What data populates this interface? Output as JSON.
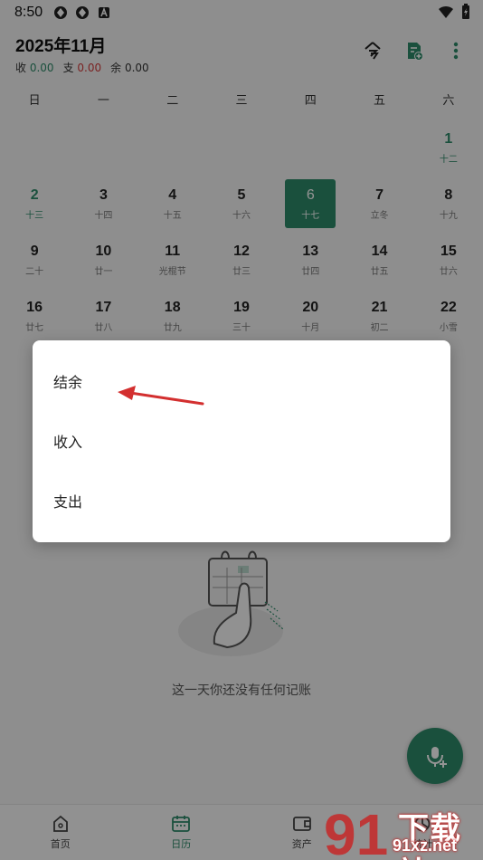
{
  "status_bar": {
    "time": "8:50"
  },
  "header": {
    "title": "2025年11月",
    "income_label": "收",
    "income_value": "0.00",
    "expense_label": "支",
    "expense_value": "0.00",
    "balance_label": "余",
    "balance_value": "0.00"
  },
  "calendar": {
    "weekdays": [
      "日",
      "一",
      "二",
      "三",
      "四",
      "五",
      "六"
    ],
    "days": [
      {
        "num": "",
        "lunar": ""
      },
      {
        "num": "",
        "lunar": ""
      },
      {
        "num": "",
        "lunar": ""
      },
      {
        "num": "",
        "lunar": ""
      },
      {
        "num": "",
        "lunar": ""
      },
      {
        "num": "",
        "lunar": ""
      },
      {
        "num": "1",
        "lunar": "十二"
      },
      {
        "num": "2",
        "lunar": "十三"
      },
      {
        "num": "3",
        "lunar": "十四"
      },
      {
        "num": "4",
        "lunar": "十五"
      },
      {
        "num": "5",
        "lunar": "十六"
      },
      {
        "num": "6",
        "lunar": "十七"
      },
      {
        "num": "7",
        "lunar": "立冬"
      },
      {
        "num": "8",
        "lunar": "十九"
      },
      {
        "num": "9",
        "lunar": "二十"
      },
      {
        "num": "10",
        "lunar": "廿一"
      },
      {
        "num": "11",
        "lunar": "光棍节"
      },
      {
        "num": "12",
        "lunar": "廿三"
      },
      {
        "num": "13",
        "lunar": "廿四"
      },
      {
        "num": "14",
        "lunar": "廿五"
      },
      {
        "num": "15",
        "lunar": "廿六"
      },
      {
        "num": "16",
        "lunar": "廿七"
      },
      {
        "num": "17",
        "lunar": "廿八"
      },
      {
        "num": "18",
        "lunar": "廿九"
      },
      {
        "num": "19",
        "lunar": "三十"
      },
      {
        "num": "20",
        "lunar": "十月"
      },
      {
        "num": "21",
        "lunar": "初二"
      },
      {
        "num": "22",
        "lunar": "小雪"
      }
    ]
  },
  "dialog": {
    "options": [
      "结余",
      "收入",
      "支出"
    ]
  },
  "empty_state": {
    "text": "这一天你还没有任何记账"
  },
  "bottom_nav": {
    "items": [
      "首页",
      "日历",
      "资产",
      "统计"
    ]
  },
  "watermark": {
    "brand_top": "下载站",
    "brand_bottom": "91xz.net",
    "logo_number": "91"
  },
  "colors": {
    "accent": "#2e8b6a",
    "expense": "#d23c3c",
    "arrow": "#d32f2f"
  }
}
